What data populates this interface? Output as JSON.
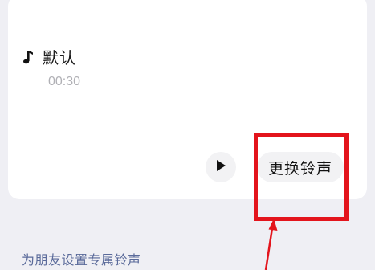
{
  "ringtone": {
    "icon": "music-note-icon",
    "name": "默认",
    "duration": "00:30"
  },
  "actions": {
    "play_icon": "play-icon",
    "change_label": "更换铃声"
  },
  "links": {
    "friend_ringtone": "为朋友设置专属铃声"
  },
  "colors": {
    "background": "#efeff4",
    "card": "#ffffff",
    "highlight": "#e3141c",
    "link": "#5a6a9a",
    "muted_text": "#b0b0b5"
  }
}
